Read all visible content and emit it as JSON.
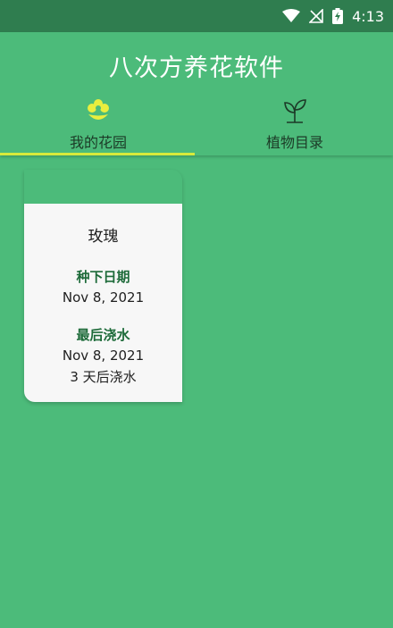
{
  "status_bar": {
    "time": "4:13"
  },
  "app": {
    "title": "八次方养花软件"
  },
  "tabs": [
    {
      "label": "我的花园",
      "icon": "flower-icon",
      "active": true
    },
    {
      "label": "植物目录",
      "icon": "sprout-icon",
      "active": false
    }
  ],
  "card": {
    "plant_name": "玫瑰",
    "planted_label": "种下日期",
    "planted_date": "Nov 8, 2021",
    "watered_label": "最后浇水",
    "watered_date": "Nov 8, 2021",
    "water_due": "3 天后浇水"
  },
  "colors": {
    "background": "#4cbb7a",
    "status_bar": "#2f7d4f",
    "accent": "#d7ea3b",
    "label_green": "#1e6b3a"
  }
}
